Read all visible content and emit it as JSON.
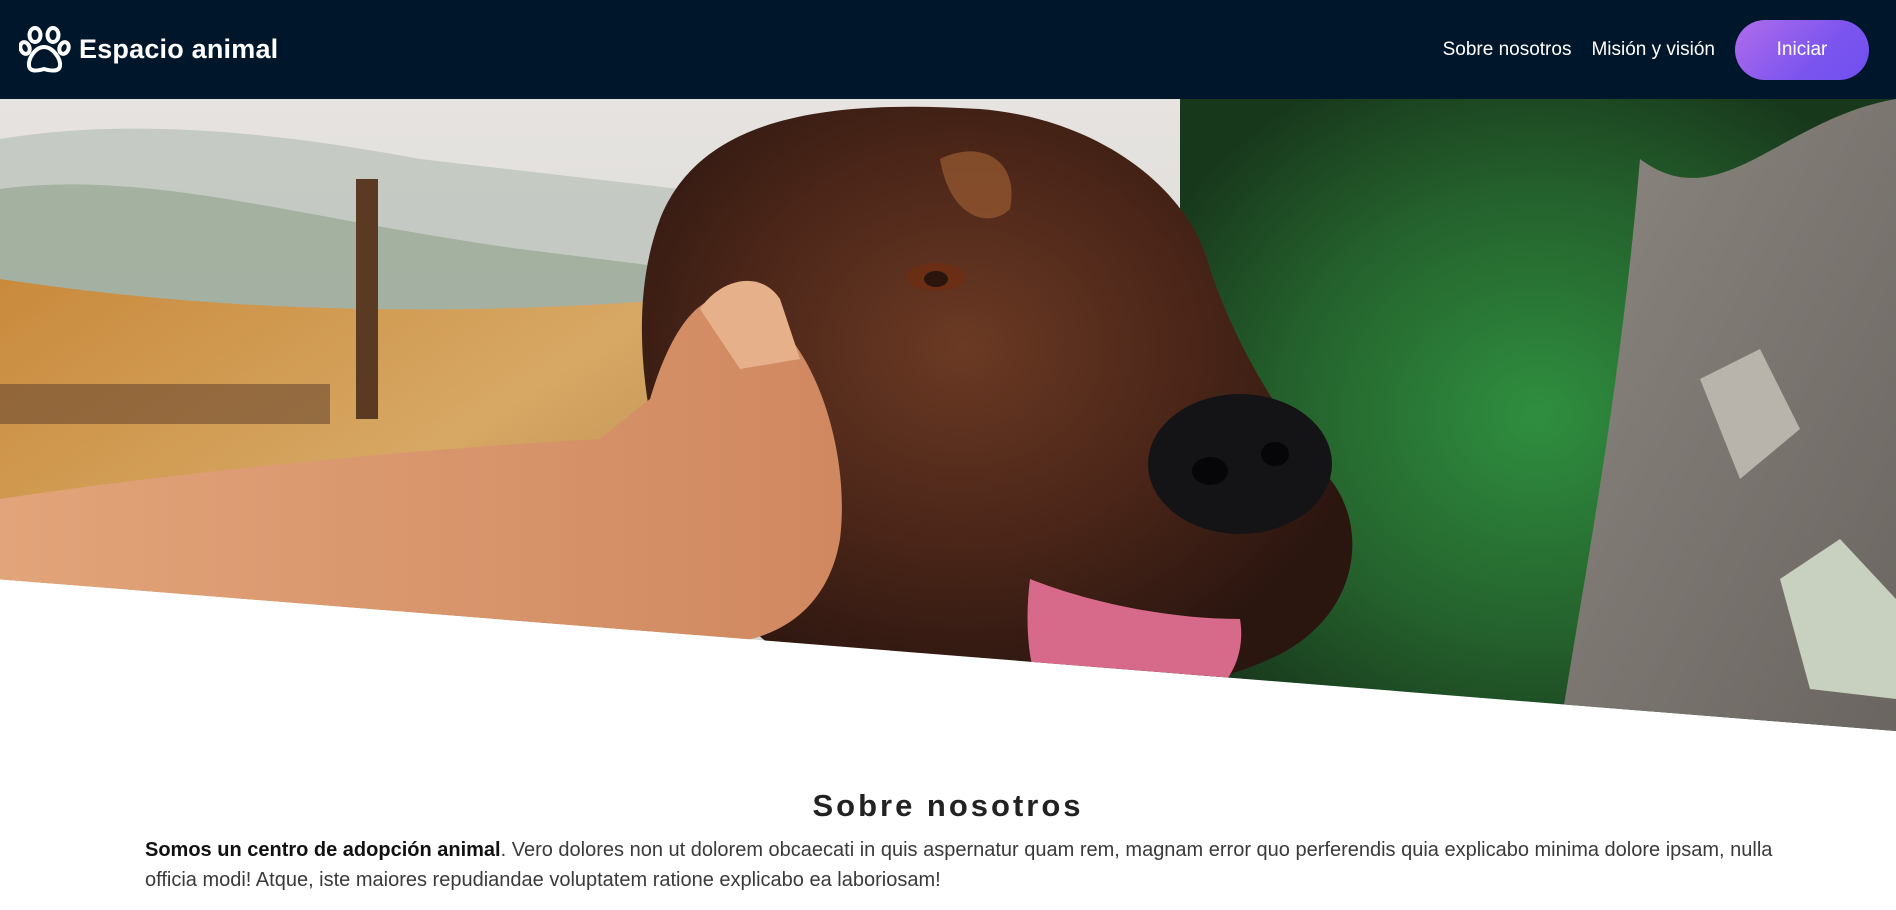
{
  "navbar": {
    "brand_name": "Espacio animal",
    "brand_icon": "paw-icon",
    "links": [
      {
        "label": "Sobre nosotros"
      },
      {
        "label": "Misión y visión"
      }
    ],
    "cta_label": "Iniciar"
  },
  "hero": {
    "image": "dog-being-petted-photo"
  },
  "about": {
    "title": "Sobre nosotros",
    "lead_bold": "Somos un centro de adopción animal",
    "body": ". Vero dolores non ut dolorem obcaecati in quis aspernatur quam rem, magnam error quo perferendis quia explicabo minima dolore ipsam, nulla officia modi! Atque, iste maiores repudiandae voluptatem ratione explicabo ea laboriosam!"
  },
  "colors": {
    "navbar_bg": "#00172b",
    "cta_gradient_start": "#b06dec",
    "cta_gradient_end": "#6e4ff0"
  }
}
